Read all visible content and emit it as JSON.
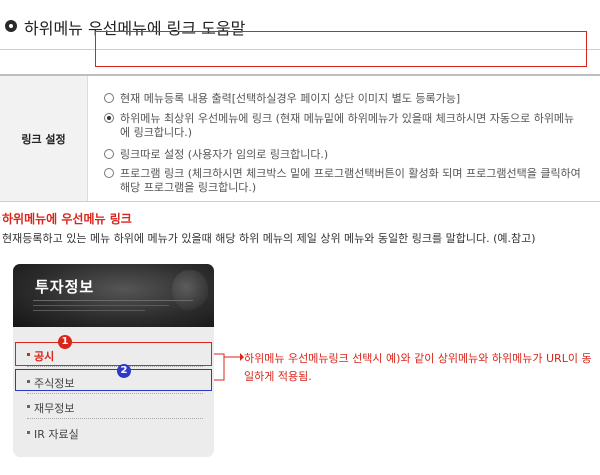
{
  "header": {
    "title": "하위메뉴 우선메뉴에 링크 도움말"
  },
  "settings": {
    "label": "링크 설정",
    "options": [
      {
        "text": "현재 메뉴등록 내용 출력[선택하실경우 페이지 상단 이미지 별도 등록가능]",
        "selected": false
      },
      {
        "text": "하위메뉴 최상위 우선메뉴에 링크 (현재 메뉴밑에 하위메뉴가 있을때 체크하시면 자동으로 하위메뉴에 링크합니다.)",
        "selected": true
      },
      {
        "text": "링크따로 설정 (사용자가 임의로 링크합니다.)",
        "selected": false
      },
      {
        "text": "프로그램 링크 (체크하시면 체크박스 밑에 프로그램선택버튼이 활성화 되며 프로그램선택을 클릭하여 해당 프로그램을 링크합니다.)",
        "selected": false
      }
    ]
  },
  "explanation": {
    "heading": "하위메뉴에 우선메뉴 링크",
    "text": "현재등록하고 있는 메뉴 하위에 메뉴가 있을때 해당 하위 메뉴의 제일 상위 메뉴와 동일한 링크를 말합니다. (예.참고)"
  },
  "example_menu": {
    "banner_title": "투자정보",
    "items": [
      "공시",
      "주식정보",
      "재무정보",
      "IR 자료실"
    ],
    "badges": [
      "1",
      "2"
    ]
  },
  "note": "하위메뉴 우선메뉴링크 선택시 예)와 같이 상위메뉴와 하위메뉴가 URL이 동일하게 적용됨.",
  "colors": {
    "accent_red": "#d9261c",
    "accent_blue": "#2d3ac9"
  }
}
